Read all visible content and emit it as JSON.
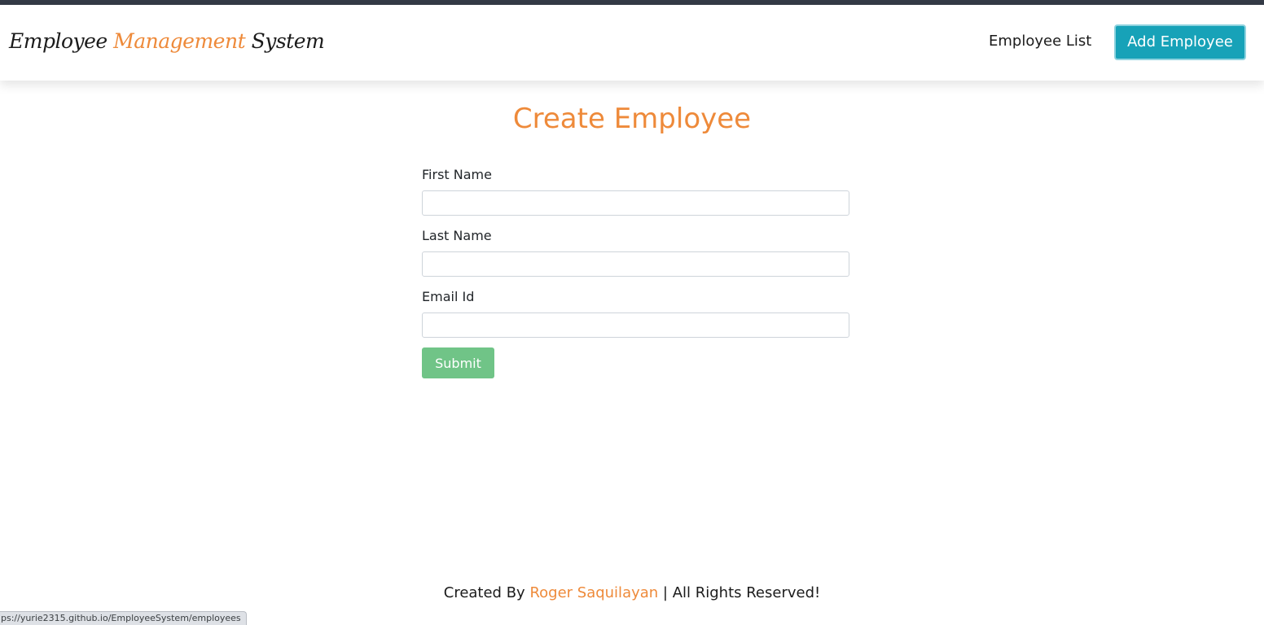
{
  "navbar": {
    "brand_part1": "Employee ",
    "brand_accent": "Management",
    "brand_part2": " System",
    "employee_list_label": "Employee List",
    "add_employee_label": "Add Employee"
  },
  "main": {
    "title": "Create Employee",
    "fields": [
      {
        "label": "First Name",
        "value": "",
        "placeholder": ""
      },
      {
        "label": "Last Name",
        "value": "",
        "placeholder": ""
      },
      {
        "label": "Email Id",
        "value": "",
        "placeholder": ""
      }
    ],
    "submit_label": "Submit"
  },
  "footer": {
    "prefix": "Created By ",
    "author": "Roger Saquilayan",
    "suffix": " | All Rights Reserved!"
  },
  "status_bar": {
    "url": "ps://yurie2315.github.io/EmployeeSystem/employees"
  },
  "colors": {
    "accent": "#ee8a3a",
    "nav_button": "#17a2b8",
    "submit_button": "#70c487",
    "top_strip": "#343a46"
  }
}
